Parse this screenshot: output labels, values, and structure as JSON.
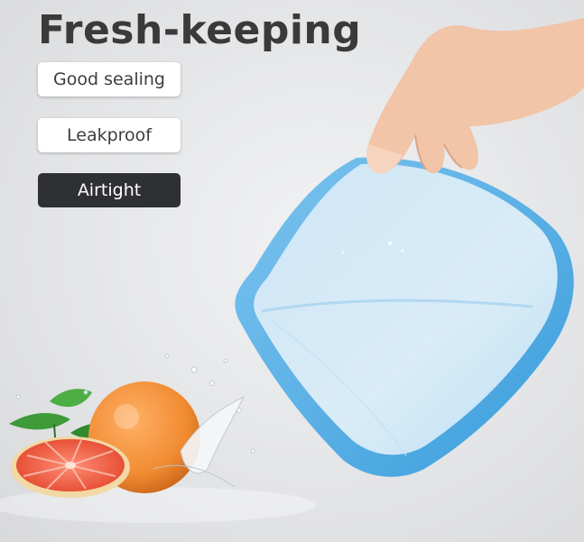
{
  "headline": "Fresh-keeping",
  "tags": [
    {
      "label": "Good sealing",
      "style": "light"
    },
    {
      "label": "Leakproof",
      "style": "light"
    },
    {
      "label": "Airtight",
      "style": "dark"
    }
  ],
  "colors": {
    "headline": "#3a3a3a",
    "tag_dark_bg": "#2f3033",
    "bag_blue": "#5fb3e6",
    "grapefruit": "#e85a3c"
  }
}
